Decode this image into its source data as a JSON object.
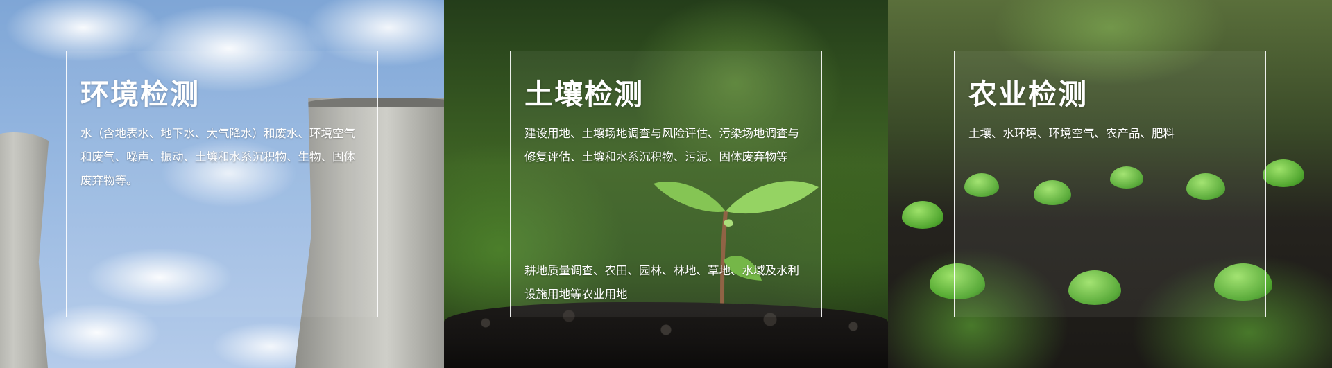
{
  "panels": [
    {
      "title": "环境检测",
      "description": "水（含地表水、地下水、大气降水）和废水、环境空气和废气、噪声、振动、土壤和水系沉积物、生物、固体废弃物等。"
    },
    {
      "title": "土壤检测",
      "description": "建设用地、土壤场地调查与风险评估、污染场地调查与修复评估、土壤和水系沉积物、污泥、固体废弃物等",
      "description2": "耕地质量调查、农田、园林、林地、草地、水域及水利设施用地等农业用地"
    },
    {
      "title": "农业检测",
      "description": "土壤、水环境、环境空气、农产品、肥料"
    }
  ],
  "colors": {
    "text": "#ffffff",
    "border": "#ffffff"
  }
}
